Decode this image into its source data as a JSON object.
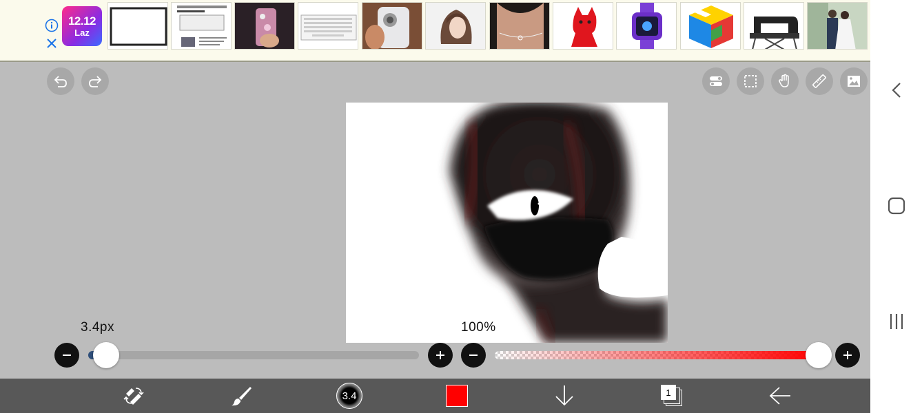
{
  "ad": {
    "logo_line1": "12.12",
    "logo_line2": "Laz",
    "info_icon": "info-icon",
    "close_icon": "close-icon",
    "thumbnails": [
      "tablet-screen-protector",
      "screen-protector-manual",
      "glitter-phone-case",
      "keyboard",
      "phone-camera-case",
      "wig",
      "belly-chain",
      "red-bulldog-speaker",
      "purple-smartwatch",
      "rubiks-cube",
      "sewing-machine",
      "wedding-photo"
    ]
  },
  "toolbar": {
    "left": [
      "undo-icon",
      "redo-icon"
    ],
    "right": [
      "toggle-icon",
      "selection-icon",
      "hand-icon",
      "ruler-icon",
      "image-icon"
    ]
  },
  "brush_size": {
    "label": "3.4px",
    "value": 3.4,
    "max": 100
  },
  "opacity": {
    "label": "100%",
    "value": 100
  },
  "bottom_bar": {
    "items": [
      "transform-icon",
      "brush-icon",
      "brush-size-icon",
      "color-swatch",
      "download-icon",
      "layers-icon",
      "back-arrow-icon"
    ],
    "brush_size_text": "3.4",
    "layer_count": "1",
    "color": "#ff0000"
  },
  "colors": {
    "workspace": "#bcbcbc",
    "accent": "#ff0000",
    "slider_fill": "#2f4f7a"
  },
  "system_nav": [
    "back-chevron-icon",
    "home-icon",
    "recents-icon"
  ]
}
